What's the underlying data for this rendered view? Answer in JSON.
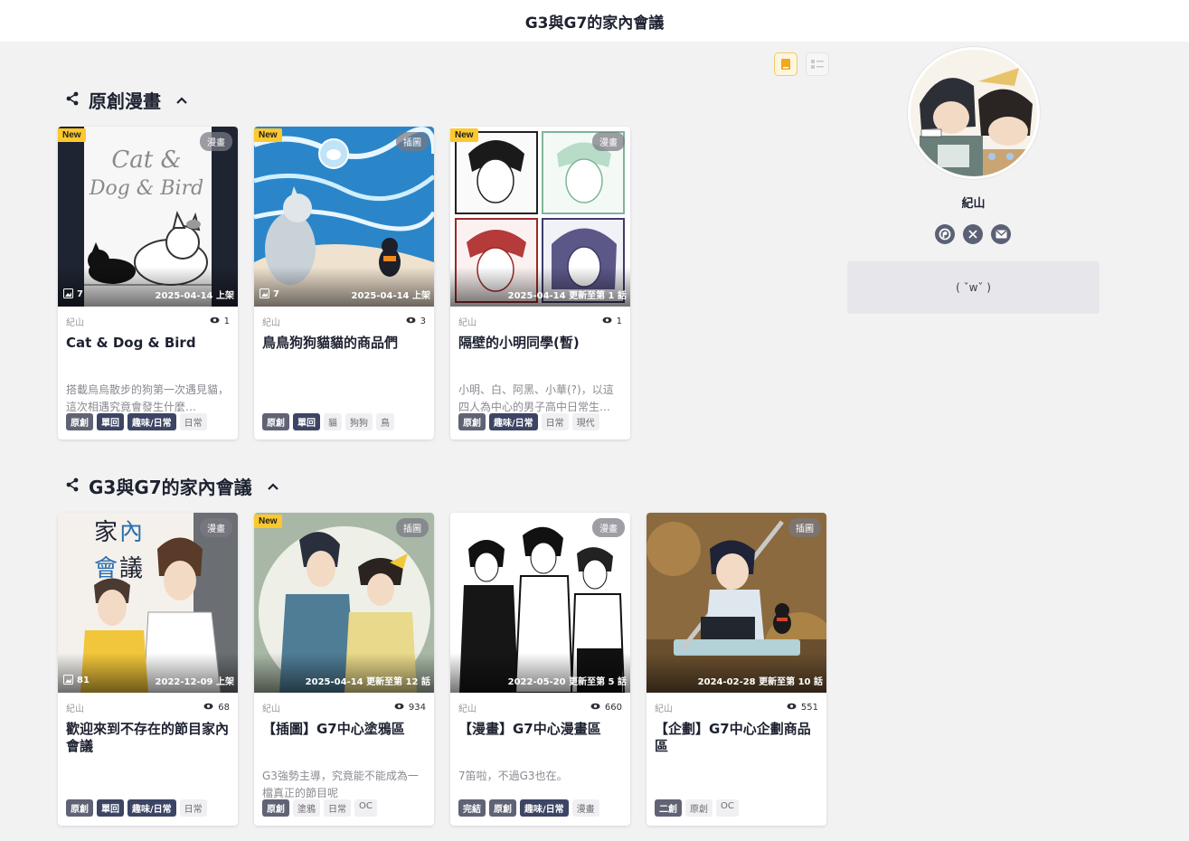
{
  "header": {
    "title": "G3與G7的家內會議"
  },
  "view_toggle": {
    "icons": [
      "card-view-icon",
      "list-view-icon"
    ],
    "active": "card-view-icon"
  },
  "sections": [
    {
      "title": "原創漫畫",
      "cards": [
        {
          "badge_new": "New",
          "type": "漫畫",
          "count": "7",
          "date": "2025-04-14 上架",
          "author": "紀山",
          "views": "1",
          "title": "Cat & Dog & Bird",
          "desc": "搭載烏烏散步的狗第一次遇見貓，這次相遇究竟會發生什麼…",
          "tags": [
            {
              "t": "原創",
              "s": "dark"
            },
            {
              "t": "單回",
              "s": "navy"
            },
            {
              "t": "趣味/日常",
              "s": "navy"
            },
            {
              "t": "日常",
              "s": "light"
            }
          ]
        },
        {
          "badge_new": "New",
          "type": "插圖",
          "count": "7",
          "date": "2025-04-14 上架",
          "author": "紀山",
          "views": "3",
          "title": "鳥鳥狗狗貓貓的商品們",
          "desc": "",
          "tags": [
            {
              "t": "原創",
              "s": "dark"
            },
            {
              "t": "單回",
              "s": "navy"
            },
            {
              "t": "貓",
              "s": "light"
            },
            {
              "t": "狗狗",
              "s": "light"
            },
            {
              "t": "鳥",
              "s": "light"
            }
          ]
        },
        {
          "badge_new": "New",
          "type": "漫畫",
          "count": "",
          "date": "2025-04-14 更新至第 1 話",
          "author": "紀山",
          "views": "1",
          "title": "隔壁的小明同學(暫)",
          "desc": "小明、白、阿黑、小華(?)，以這四人為中心的男子高中日常生…",
          "tags": [
            {
              "t": "原創",
              "s": "dark"
            },
            {
              "t": "趣味/日常",
              "s": "navy"
            },
            {
              "t": "日常",
              "s": "light"
            },
            {
              "t": "現代",
              "s": "light"
            }
          ]
        }
      ]
    },
    {
      "title": "G3與G7的家內會議",
      "cards": [
        {
          "badge_new": "",
          "type": "漫畫",
          "count": "81",
          "date": "2022-12-09 上架",
          "author": "紀山",
          "views": "68",
          "title": "歡迎來到不存在的節目家內會議",
          "desc": "",
          "tags": [
            {
              "t": "原創",
              "s": "dark"
            },
            {
              "t": "單回",
              "s": "navy"
            },
            {
              "t": "趣味/日常",
              "s": "navy"
            },
            {
              "t": "日常",
              "s": "light"
            }
          ]
        },
        {
          "badge_new": "New",
          "type": "插圖",
          "count": "",
          "date": "2025-04-14 更新至第 12 話",
          "author": "紀山",
          "views": "934",
          "title": "【插圖】G7中心塗鴉區",
          "desc": "G3強勢主導，究竟能不能成為一檔真正的節目呢",
          "tags": [
            {
              "t": "原創",
              "s": "dark"
            },
            {
              "t": "塗鴉",
              "s": "light"
            },
            {
              "t": "日常",
              "s": "light"
            },
            {
              "t": "OC",
              "s": "light"
            }
          ]
        },
        {
          "badge_new": "",
          "type": "漫畫",
          "count": "",
          "date": "2022-05-20 更新至第 5 話",
          "author": "紀山",
          "views": "660",
          "title": "【漫畫】G7中心漫畫區",
          "desc": "7笛啦，不過G3也在。",
          "tags": [
            {
              "t": "完結",
              "s": "dark"
            },
            {
              "t": "原創",
              "s": "dark"
            },
            {
              "t": "趣味/日常",
              "s": "navy"
            },
            {
              "t": "漫畫",
              "s": "light"
            }
          ]
        },
        {
          "badge_new": "",
          "type": "插圖",
          "count": "",
          "date": "2024-02-28 更新至第 10 話",
          "author": "紀山",
          "views": "551",
          "title": "【企劃】G7中心企劃商品區",
          "desc": "",
          "tags": [
            {
              "t": "二創",
              "s": "dark"
            },
            {
              "t": "原創",
              "s": "light"
            },
            {
              "t": "OC",
              "s": "light"
            }
          ]
        }
      ]
    }
  ],
  "profile": {
    "name": "紀山",
    "bio": "( ˇwˇ )",
    "socials": [
      "plurk-icon",
      "x-icon",
      "mail-icon"
    ]
  },
  "colors": {
    "new_badge": "#fcc82d",
    "tag_dark": "#5f6374",
    "tag_navy": "#3d4564",
    "active_toggle": "#f3c86a"
  }
}
